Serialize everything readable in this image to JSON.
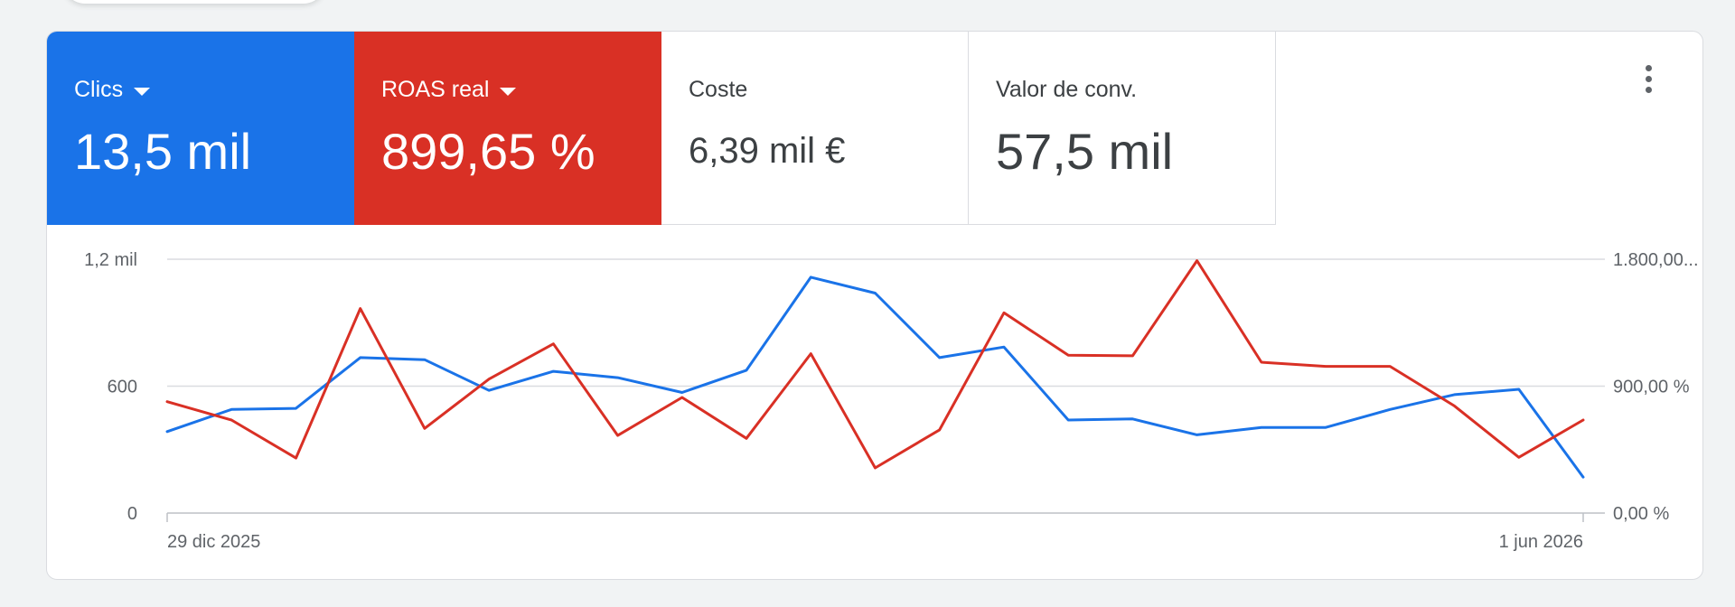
{
  "metrics": [
    {
      "label": "Clics",
      "value": "13,5 mil",
      "selected": true,
      "color": "#1a73e8",
      "dropdown": true
    },
    {
      "label": "ROAS real",
      "value": "899,65 %",
      "selected": true,
      "color": "#d93025",
      "dropdown": true
    },
    {
      "label": "Coste",
      "value": "6,39 mil €",
      "selected": false,
      "dropdown": false
    },
    {
      "label": "Valor de conv.",
      "value": "57,5 mil",
      "selected": false,
      "dropdown": false
    }
  ],
  "menu_icon": "more-vert-icon",
  "chart_data": {
    "type": "line",
    "x": [
      "29 dic 2025",
      "",
      "",
      "",
      "",
      "",
      "",
      "",
      "",
      "",
      "",
      "",
      "",
      "",
      "",
      "",
      "",
      "",
      "",
      "",
      "",
      "",
      "1 jun 2026"
    ],
    "x_tick_labels": [
      "29 dic 2025",
      "1 jun 2026"
    ],
    "series": [
      {
        "name": "Clics",
        "axis": "left",
        "color": "#1a73e8",
        "values": [
          385,
          490,
          495,
          735,
          725,
          580,
          670,
          640,
          570,
          675,
          1115,
          1040,
          735,
          785,
          440,
          445,
          370,
          405,
          405,
          490,
          560,
          585,
          170
        ]
      },
      {
        "name": "ROAS real",
        "axis": "right",
        "color": "#d93025",
        "values": [
          790,
          660,
          390,
          1450,
          600,
          950,
          1200,
          550,
          820,
          530,
          1130,
          320,
          590,
          1420,
          1120,
          1115,
          1790,
          1070,
          1040,
          1040,
          760,
          395,
          660
        ]
      }
    ],
    "y_left": {
      "ticks": [
        0,
        600,
        1200
      ],
      "tick_labels": [
        "0",
        "600",
        "1,2 mil"
      ],
      "lim": [
        0,
        1200
      ]
    },
    "y_right": {
      "ticks": [
        0,
        900,
        1800
      ],
      "tick_labels": [
        "0,00 %",
        "900,00 %",
        "1.800,00..."
      ],
      "lim": [
        0,
        1800
      ]
    },
    "grid": true
  }
}
